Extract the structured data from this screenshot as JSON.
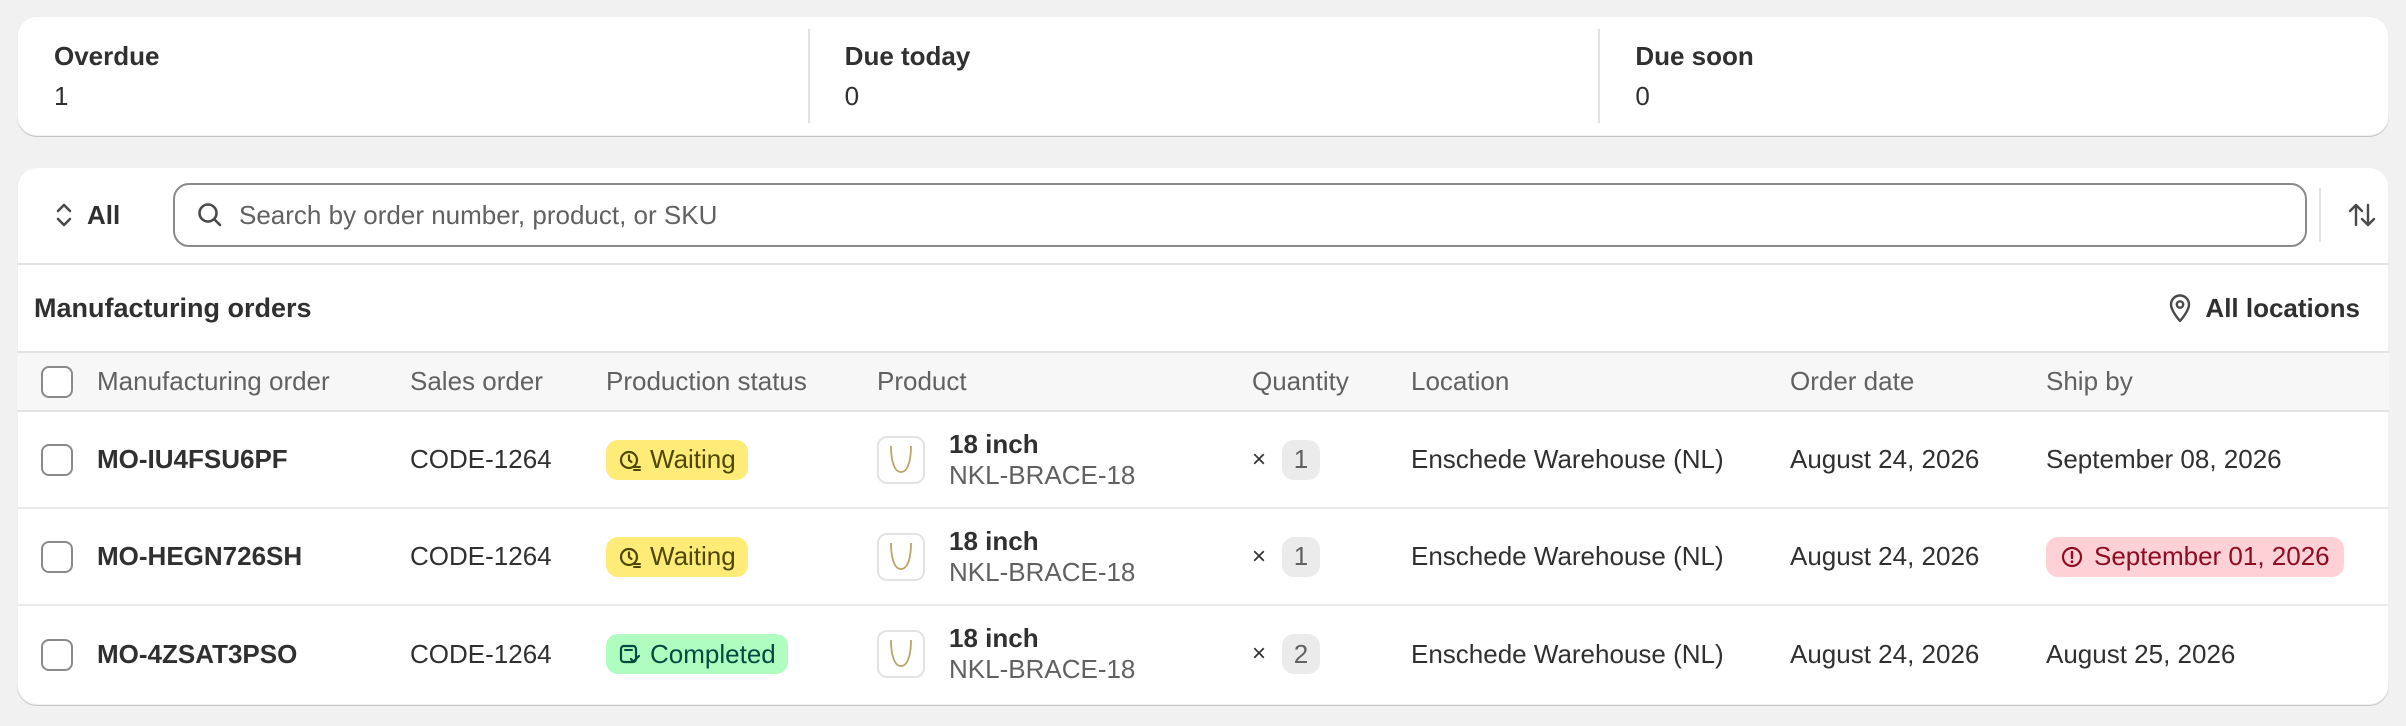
{
  "metrics": [
    {
      "label": "Overdue",
      "value": "1"
    },
    {
      "label": "Due today",
      "value": "0"
    },
    {
      "label": "Due soon",
      "value": "0"
    }
  ],
  "toolbar": {
    "filter_label": "All",
    "search_placeholder": "Search by order number, product, or SKU"
  },
  "section": {
    "title": "Manufacturing orders",
    "locations_label": "All locations"
  },
  "columns": {
    "mo": "Manufacturing order",
    "sales": "Sales order",
    "status": "Production status",
    "product": "Product",
    "quantity": "Quantity",
    "location": "Location",
    "order_date": "Order date",
    "ship_by": "Ship by"
  },
  "rows": [
    {
      "mo": "MO-IU4FSU6PF",
      "sales": "CODE-1264",
      "status": "Waiting",
      "product": "18 inch",
      "sku": "NKL-BRACE-18",
      "qty_x": "×",
      "qty": "1",
      "location": "Enschede Warehouse (NL)",
      "order_date": "August 24, 2026",
      "ship_by": "September 08, 2026"
    },
    {
      "mo": "MO-HEGN726SH",
      "sales": "CODE-1264",
      "status": "Waiting",
      "product": "18 inch",
      "sku": "NKL-BRACE-18",
      "qty_x": "×",
      "qty": "1",
      "location": "Enschede Warehouse (NL)",
      "order_date": "August 24, 2026",
      "ship_by": "September 01, 2026"
    },
    {
      "mo": "MO-4ZSAT3PSO",
      "sales": "CODE-1264",
      "status": "Completed",
      "product": "18 inch",
      "sku": "NKL-BRACE-18",
      "qty_x": "×",
      "qty": "2",
      "location": "Enschede Warehouse (NL)",
      "order_date": "August 24, 2026",
      "ship_by": "August 25, 2026"
    }
  ],
  "colors": {
    "waiting_bg": "#ffeb78",
    "completed_bg": "#affebf",
    "overdue_bg": "#fed1d7",
    "overdue_text": "#8e0b21"
  }
}
